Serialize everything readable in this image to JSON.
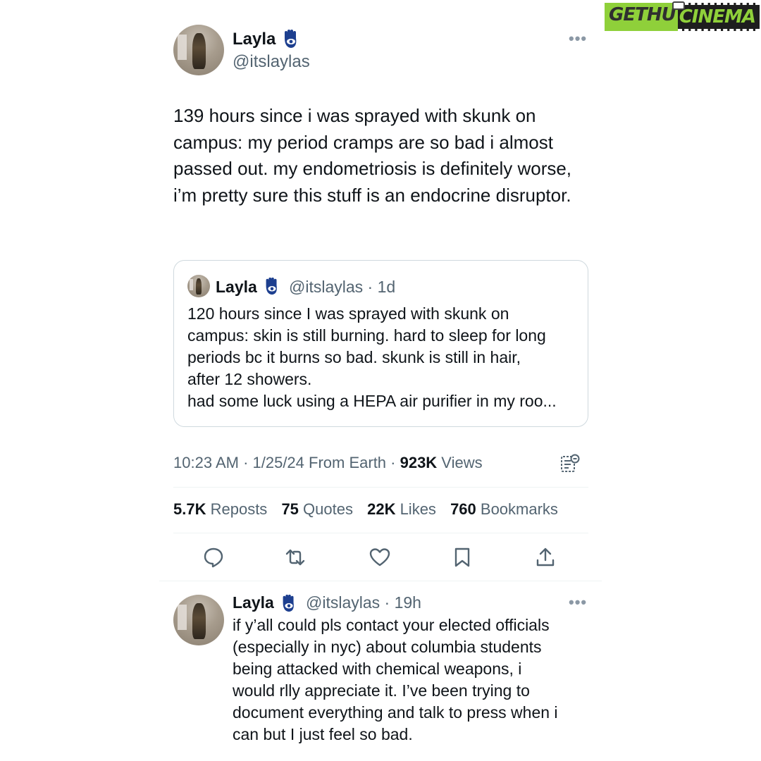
{
  "watermark": {
    "part1": "GETHU",
    "part2": "CINEMA"
  },
  "main_tweet": {
    "author": {
      "name": "Layla",
      "handle": "@itslaylas"
    },
    "text": "139 hours since i was sprayed with skunk on campus: my period cramps are so bad i almost passed out. my endometriosis is definitely worse, i’m pretty sure this stuff is an endocrine disruptor.",
    "more_label": "•••"
  },
  "quoted_tweet": {
    "name": "Layla",
    "handle_time": "@itslaylas · 1d",
    "text_lines": [
      "120 hours since I was sprayed with skunk on",
      "campus: skin is still burning. hard to sleep for long",
      "periods bc it burns so bad. skunk is still in hair,",
      "after 12 showers.",
      "had some luck using a HEPA air purifier in my roo..."
    ]
  },
  "meta": {
    "time_date_source": "10:23 AM · 1/25/24 From Earth · ",
    "views_count": "923K",
    "views_label": " Views"
  },
  "stats": {
    "reposts_count": "5.7K",
    "reposts_label": " Reposts",
    "quotes_count": "75",
    "quotes_label": " Quotes",
    "likes_count": "22K",
    "likes_label": " Likes",
    "bookmarks_count": "760",
    "bookmarks_label": " Bookmarks"
  },
  "actions": [
    "reply-icon",
    "repost-icon",
    "like-icon",
    "bookmark-icon",
    "share-icon"
  ],
  "reply_tweet": {
    "name": "Layla",
    "handle_time": "@itslaylas · 19h",
    "text_lines": [
      "if y’all could pls contact your elected officials",
      "(especially in nyc) about columbia students",
      "being attacked with chemical weapons, i",
      "would rlly appreciate it. I’ve been trying to",
      "document everything and talk to press when i",
      "can but I just feel so bad."
    ],
    "more_label": "•••"
  },
  "colors": {
    "text": "#0f1419",
    "secondary": "#536471",
    "border": "#cfd9de",
    "badge": "#1d3f8f"
  }
}
